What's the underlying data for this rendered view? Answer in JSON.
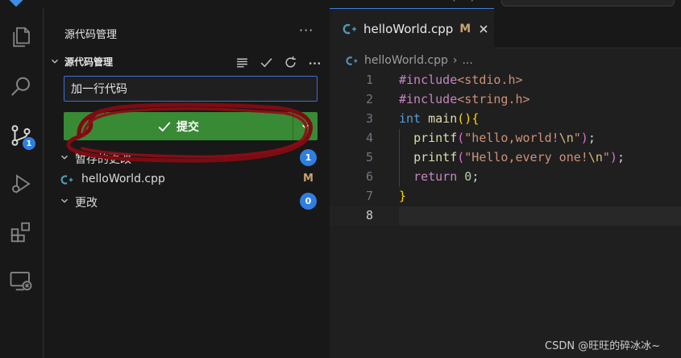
{
  "colors": {
    "accent": "#2f7ee0",
    "commit_button": "#388a34",
    "modified": "#c9a26d",
    "annotation": "#8b0a14"
  },
  "activity_bar": {
    "items": [
      {
        "name": "explorer-icon"
      },
      {
        "name": "search-icon"
      },
      {
        "name": "source-control-icon",
        "badge": "1"
      },
      {
        "name": "run-debug-icon"
      },
      {
        "name": "extensions-icon"
      },
      {
        "name": "remote-explorer-icon"
      }
    ]
  },
  "sidebar": {
    "title": "源代码管理",
    "more": "···",
    "section": {
      "title": "源代码管理",
      "tools": [
        "list-view-icon",
        "check-icon",
        "refresh-icon",
        "more-icon"
      ]
    },
    "commit_message": "加一行代码",
    "commit_label": "提交",
    "groups": [
      {
        "label": "暂存的更改",
        "count": "1"
      },
      {
        "label": "更改",
        "count": "0"
      }
    ],
    "files": [
      {
        "name": "helloWorld.cpp",
        "status": "M"
      }
    ]
  },
  "editor": {
    "tab": {
      "name": "helloWorld.cpp",
      "status": "M"
    },
    "breadcrumb": {
      "file": "helloWorld.cpp",
      "rest": "..."
    },
    "current_line": "8",
    "lines": [
      {
        "no": "1",
        "text": "#include<stdio.h>"
      },
      {
        "no": "2",
        "text": "#include<string.h>"
      },
      {
        "no": "3",
        "text": "int main(){"
      },
      {
        "no": "4",
        "text": "  printf(\"hello,world!\\n\");"
      },
      {
        "no": "5",
        "text": "  printf(\"Hello,every one!\\n\");"
      },
      {
        "no": "6",
        "text": "  return 0;"
      },
      {
        "no": "7",
        "text": "}"
      },
      {
        "no": "8",
        "text": ""
      }
    ]
  },
  "watermark": "CSDN @旺旺的碎冰冰~"
}
